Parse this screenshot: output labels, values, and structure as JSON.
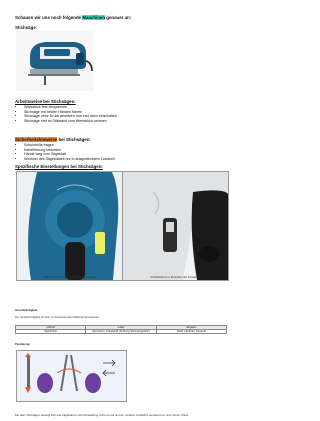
{
  "intro": {
    "before": "Schauen wir uns noch folgende ",
    "highlight": "Maschinen",
    "after": " genauer an:"
  },
  "stichsaege": {
    "title": "Stichsäge:"
  },
  "arbeitsweise": {
    "title": "Arbeitsweise bei Stichsägen:",
    "items": [
      "Werkstück fest einspannen",
      "Stichsäge mit beiden Händen führen",
      "Stichsäge ohne Druck ansetzen und erst dann einschalten",
      "Stichsäge erst im Stillstand vom Werkstück nehmen"
    ]
  },
  "sicherheit": {
    "title_highlight": "Sicherheitshinweise",
    "title_rest": " bei Stichsägen:",
    "items": [
      "Schutzbrille tragen",
      "Kabelführung beachten",
      "Hände weg vom Sägeblatt",
      "Wechsel des Sägeblattes nur in ausgestecktem Zustand!"
    ]
  },
  "einstellungen": {
    "title": "Spezifische Einstellungen bei Stichsägen:",
    "caption_left": "Drehknopf zum wählen der Geschwindigkeit",
    "caption_right": "Schalthebel zum Einstellen der Pendelung"
  },
  "geschwindigkeit": {
    "title": "Geschwindigkeit:",
    "text": "Die Geschwindigkeit ist dem zu bearbeitenden Material anzupassen:",
    "table": {
      "headers": [
        "schnell",
        "mittel",
        "langsam"
      ],
      "row": [
        "Weichholz",
        "Aluminium, Kunststoff (Achtung Schmelzgefahr!)",
        "Stahl, Hartholz, Keramik"
      ]
    }
  },
  "pendelung": {
    "title": "Pendelung:",
    "footer": "Bei allen Stichsägen bewegt sich das Sägeblatt je nach Einstellung nicht nur auf und ab, sondern zusätzlich pendelnd vor und zurück. Diese"
  },
  "colors": {
    "teal_highlight": "#39e0c6",
    "orange_highlight": "#f08b3a",
    "tool_blue": "#1d5f86"
  }
}
